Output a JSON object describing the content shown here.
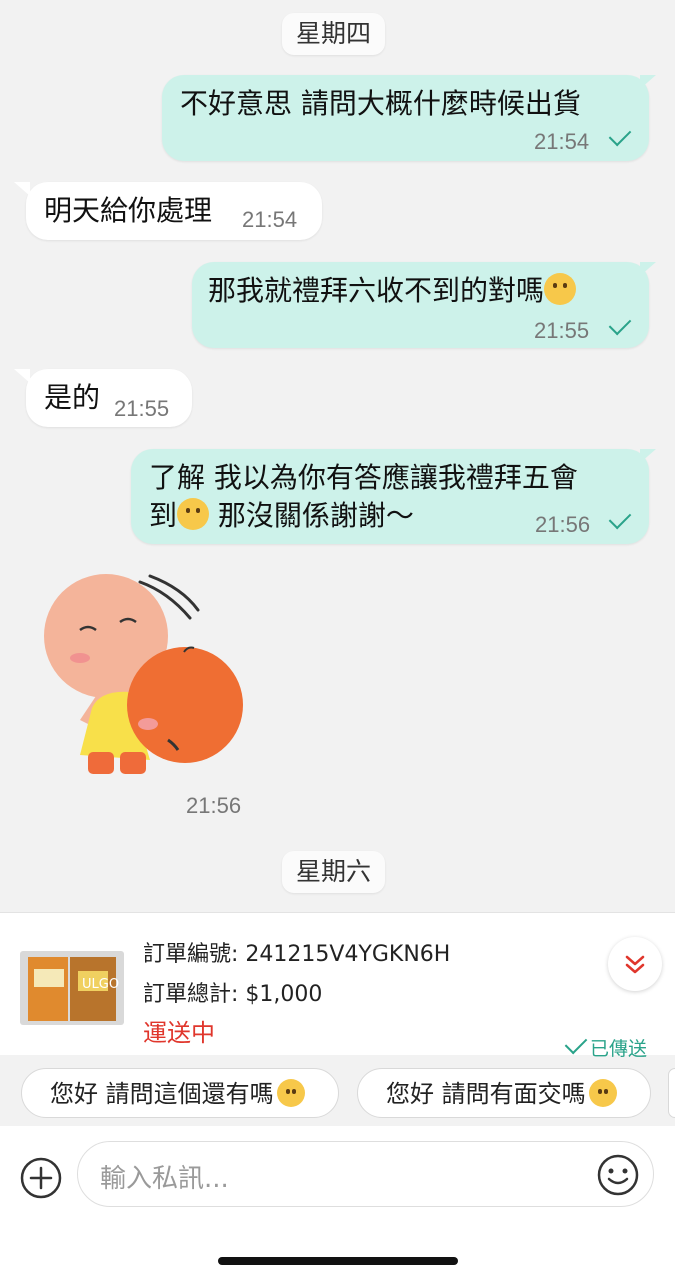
{
  "day_labels": {
    "thursday": "星期四",
    "saturday": "星期六"
  },
  "messages": [
    {
      "from": "me",
      "text": "不好意思 請問大概什麼時候出貨",
      "time": "21:54"
    },
    {
      "from": "them",
      "text": "明天給你處理",
      "time": "21:54"
    },
    {
      "from": "me",
      "text": "那我就禮拜六收不到的對嗎",
      "emoji": "crying-face",
      "time": "21:55"
    },
    {
      "from": "them",
      "text": "是的",
      "time": "21:55"
    },
    {
      "from": "me",
      "line1": "了解 我以為你有答應讓我禮拜五會",
      "line2_a": "到",
      "emoji": "tears-of-joy",
      "line2_b": " 那沒關係謝謝～",
      "time": "21:56"
    },
    {
      "from": "them",
      "type": "sticker",
      "time": "21:56"
    }
  ],
  "order": {
    "number_label": "訂單編號: 241215V4YGKN6H",
    "total_label": "訂單總計: $1,000",
    "status": "運送中",
    "thumbnail_watermark": "ULGO",
    "sent_label": "已傳送"
  },
  "quick_replies": [
    {
      "text": "您好 請問這個還有嗎",
      "emoji": "grinning-face"
    },
    {
      "text": "您好 請問有面交嗎",
      "emoji": "relieved-face"
    }
  ],
  "composer": {
    "placeholder": "輸入私訊..."
  },
  "colors": {
    "outgoing": "#cdf2ea",
    "incoming": "#ffffff",
    "status_red": "#e0362c",
    "check_green": "#2aa38a"
  }
}
